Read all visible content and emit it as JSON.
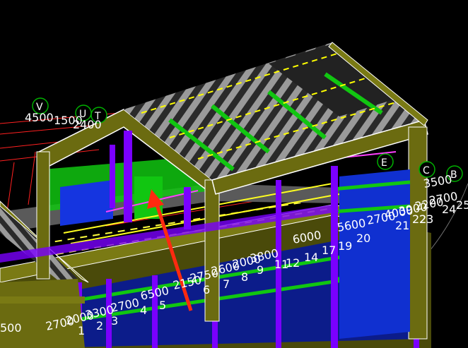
{
  "viewport": {
    "background": "#000000",
    "colors": {
      "frame": "#6b6b10",
      "column": "#7a00ff",
      "slab": "#11c611",
      "gridline": "#ff2020",
      "dimension_line": "#ffff00",
      "arrow": "#ff2a10",
      "wall": "#1030d0",
      "grid_bubble": "#00b000"
    },
    "grid_bubbles": [
      "V",
      "U",
      "T",
      "E",
      "C",
      "B"
    ],
    "dimension_texts_left": [
      "4500",
      "1500",
      "2400"
    ],
    "dimension_texts_front": [
      "500",
      "2700",
      "2000",
      "3300",
      "2700",
      "6500",
      "2150",
      "2750",
      "2600",
      "2000",
      "3800"
    ],
    "dimension_texts_right": [
      "6000",
      "5600",
      "2700",
      "4000",
      "3900",
      "2200",
      "2700",
      "3500",
      "25"
    ],
    "grid_numbers_front": [
      "1",
      "2",
      "3",
      "4",
      "5",
      "6",
      "7",
      "8",
      "9",
      "11",
      "12",
      "14",
      "17",
      "19",
      "20",
      "21",
      "22",
      "23",
      "24"
    ]
  }
}
